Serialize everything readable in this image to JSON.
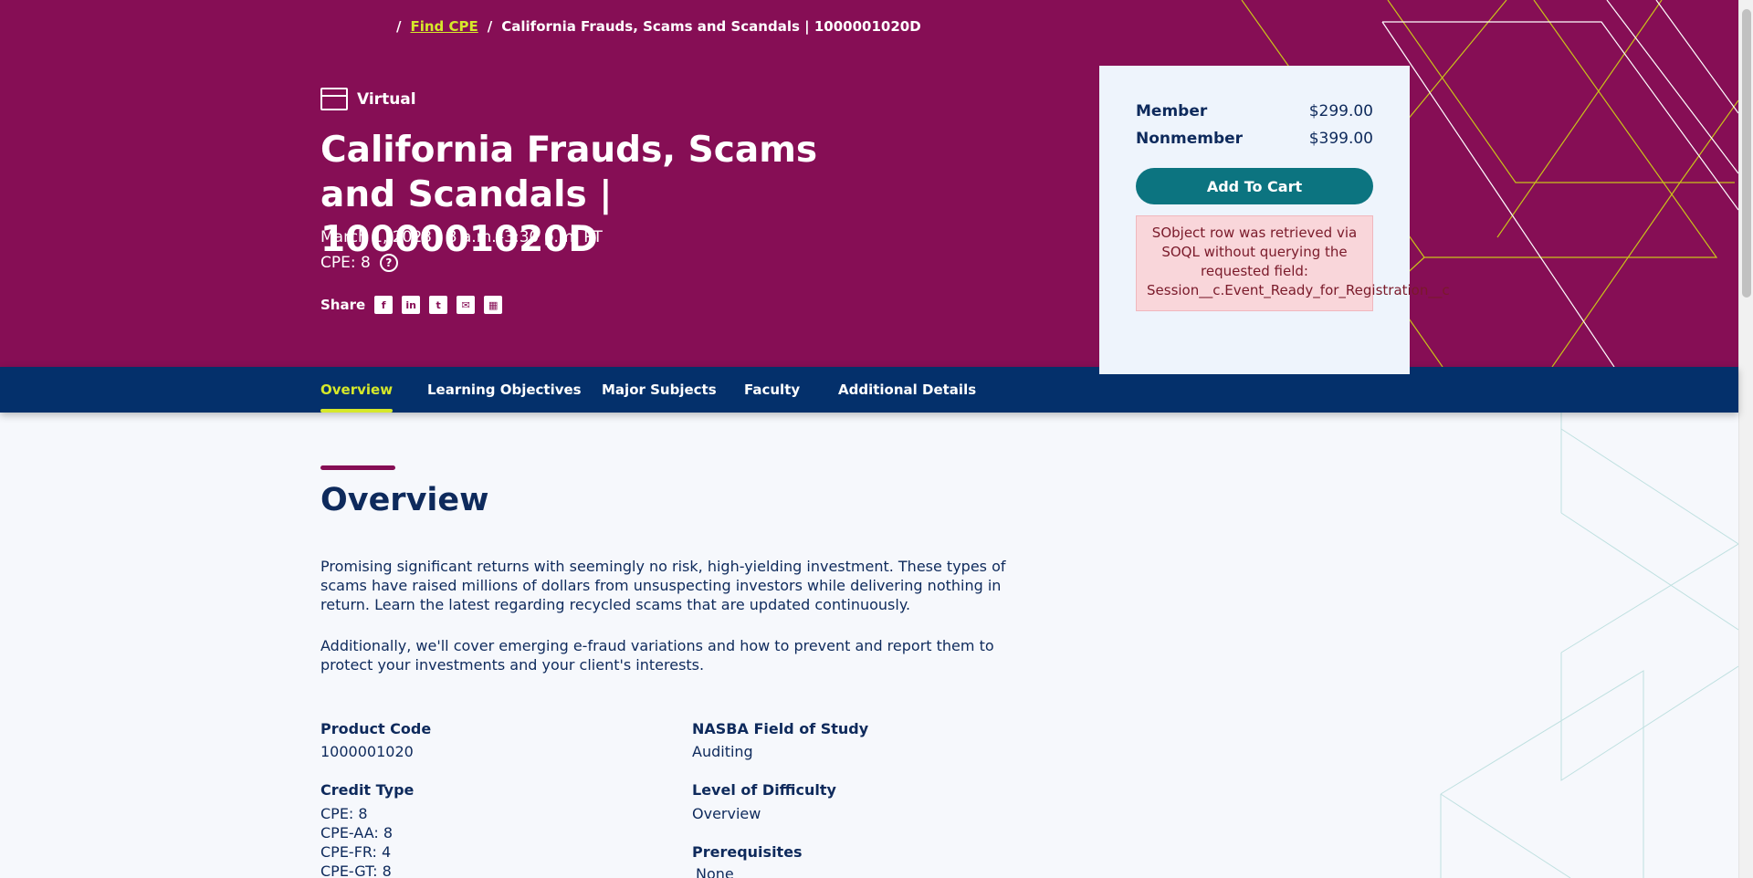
{
  "breadcrumb": {
    "sep1": "/",
    "link": "Find CPE",
    "sep2": "/",
    "current": "California Frauds, Scams and Scandals | 1000001020D"
  },
  "hero": {
    "mode": "Virtual",
    "title": "California Frauds, Scams and Scandals | 1000001020D",
    "date": "March 1, 2023 | 8 a.m.–3:30 p.m. PT",
    "cpe": "CPE: 8",
    "help_glyph": "?",
    "share_label": "Share",
    "share_icons": [
      "facebook-icon",
      "linkedin-icon",
      "twitter-icon",
      "email-icon",
      "calendar-icon"
    ]
  },
  "pricing": {
    "member_label": "Member",
    "member_price": "$299.00",
    "nonmember_label": "Nonmember",
    "nonmember_price": "$399.00",
    "cart_label": "Add To Cart",
    "error_line1": "SObject row was retrieved via",
    "error_line2": "SOQL without querying the",
    "error_line3": "requested field:",
    "error_line4": "Session__c.Event_Ready_for_Registration__c"
  },
  "tabs": [
    {
      "label": "Overview",
      "active": true
    },
    {
      "label": "Learning Objectives",
      "active": false
    },
    {
      "label": "Major Subjects",
      "active": false
    },
    {
      "label": "Faculty",
      "active": false
    },
    {
      "label": "Additional Details",
      "active": false
    }
  ],
  "overview": {
    "title": "Overview",
    "para1": "Promising significant returns with seemingly no risk, high-yielding investment. These types of scams have raised millions of dollars from unsuspecting investors while delivering nothing in return. Learn the latest regarding recycled scams that are updated continuously.",
    "para2": "Additionally, we'll cover emerging e-fraud variations and how to prevent and report them to protect your investments and your client's interests."
  },
  "details": {
    "product_code_label": "Product Code",
    "product_code": "1000001020",
    "credit_type_label": "Credit Type",
    "credit_types": [
      "CPE: 8",
      "CPE-AA: 8",
      "CPE-FR: 4",
      "CPE-GT: 8"
    ],
    "field_label": "NASBA Field of Study",
    "field": "Auditing",
    "level_label": "Level of Difficulty",
    "level": "Overview",
    "prereq_label": "Prerequisites",
    "prereq": "None"
  },
  "colors": {
    "hero_bg": "#860e55",
    "tab_bg": "#04306b",
    "accent": "#d6e82a",
    "button": "#0c7480",
    "error_bg": "#f9d6da"
  }
}
